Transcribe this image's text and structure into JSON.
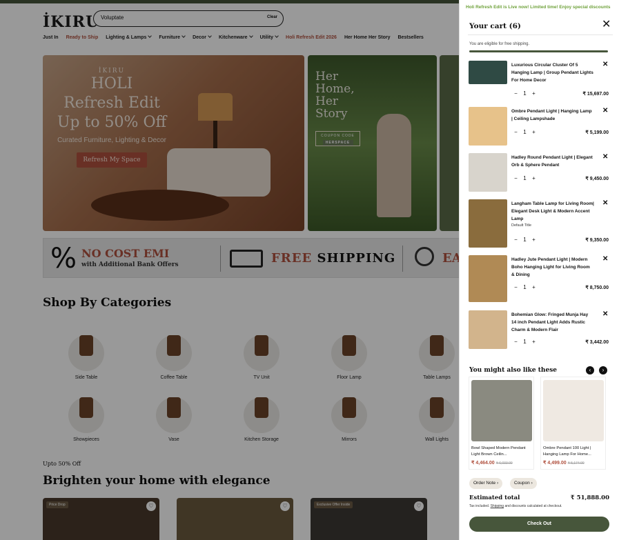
{
  "header": {
    "logo": "İKIRU",
    "search_value": "Voluptate",
    "search_clear": "Clear",
    "nav": [
      "Just In",
      "Ready to Ship",
      "Lighting & Lamps",
      "Furniture",
      "Decor",
      "Kitchenware",
      "Utility",
      "Holi Refresh Edit 2026",
      "Her Home Her Story",
      "Bestsellers"
    ]
  },
  "hero": {
    "brand": "İKIRU",
    "headline_1": "HOLI",
    "headline_2": "Refresh Edit",
    "headline_3": "Up to 50% Off",
    "subline": "Curated Furniture, Lighting & Decor",
    "cta": "Refresh My Space",
    "story_title": "Her Home, Her Story",
    "coupon_label": "COUPON CODE",
    "coupon_code": "HERSPACE"
  },
  "banner": {
    "emi_title": "NO COST EMI",
    "emi_sub": "with Additional Bank Offers",
    "ship_red": "FREE",
    "ship_black": "SHIPPING",
    "third": "EA"
  },
  "categories": {
    "title": "Shop By Categories",
    "items": [
      "Side Table",
      "Coffee Table",
      "TV Unit",
      "Floor Lamp",
      "Table Lamps",
      "Showpieces",
      "Vase",
      "Kitchen Storage",
      "Mirrors",
      "Wall Lights"
    ]
  },
  "collection": {
    "eyebrow": "Upto 50% Off",
    "title": "Brighten your home with elegance",
    "tags": [
      "Price Drop",
      "",
      "Exclusive Offer Inside"
    ]
  },
  "cart": {
    "promo": "Holi Refresh Edit is Live now! Limited time! Enjoy special discounts",
    "title": "Your cart (6)",
    "eligible": "You are eligible for free shipping.",
    "items": [
      {
        "name": "Luxurious Circular Cluster Of 5 Hanging Lamp | Group Pendant Lights For Home Decor",
        "sub": "",
        "qty": "1",
        "price": "₹ 15,697.00"
      },
      {
        "name": "Ombre Pendant Light | Hanging Lamp | Ceiling Lampshade",
        "sub": "",
        "qty": "1",
        "price": "₹ 5,199.00"
      },
      {
        "name": "Hadley Round Pendant Light | Elegant Orb & Sphere Pendant",
        "sub": "",
        "qty": "1",
        "price": "₹ 9,450.00"
      },
      {
        "name": "Langham Table Lamp for Living Room| Elegant Desk Light & Modern Accent Lamp",
        "sub": "Default Title",
        "qty": "1",
        "price": "₹ 9,350.00"
      },
      {
        "name": "Hadley Jute Pendant Light | Modern Boho Hanging Light for Living Room & Dining",
        "sub": "",
        "qty": "1",
        "price": "₹ 8,750.00"
      },
      {
        "name": "Bohemian Glow: Fringed Munja Hay 14 inch Pendant Light Adds Rustic Charm & Modern Flair",
        "sub": "",
        "qty": "1",
        "price": "₹ 3,442.00"
      }
    ],
    "also_like": "You might also like these",
    "recommendations": [
      {
        "name": "Bowl Shaped Modern Pendant Light Brown Ceilin...",
        "price": "₹ 4,464.00",
        "was": "₹ 6,033.00"
      },
      {
        "name": "Ombre Pendant 100 Light | Hanging Lamp For Home...",
        "price": "₹ 4,499.00",
        "was": "₹ 5,174.00"
      }
    ],
    "order_note": "Order Note",
    "coupon": "Coupon",
    "estimated_label": "Estimated total",
    "estimated_value": "₹ 51,888.00",
    "tax_a": "Tax included.",
    "tax_link": "Shipping",
    "tax_b": "and discounts calculated at checkout.",
    "checkout": "Check Out"
  },
  "colors": {
    "accent_green": "#47563b",
    "promo_green": "#6ea13a",
    "terracotta": "#b0503e"
  }
}
